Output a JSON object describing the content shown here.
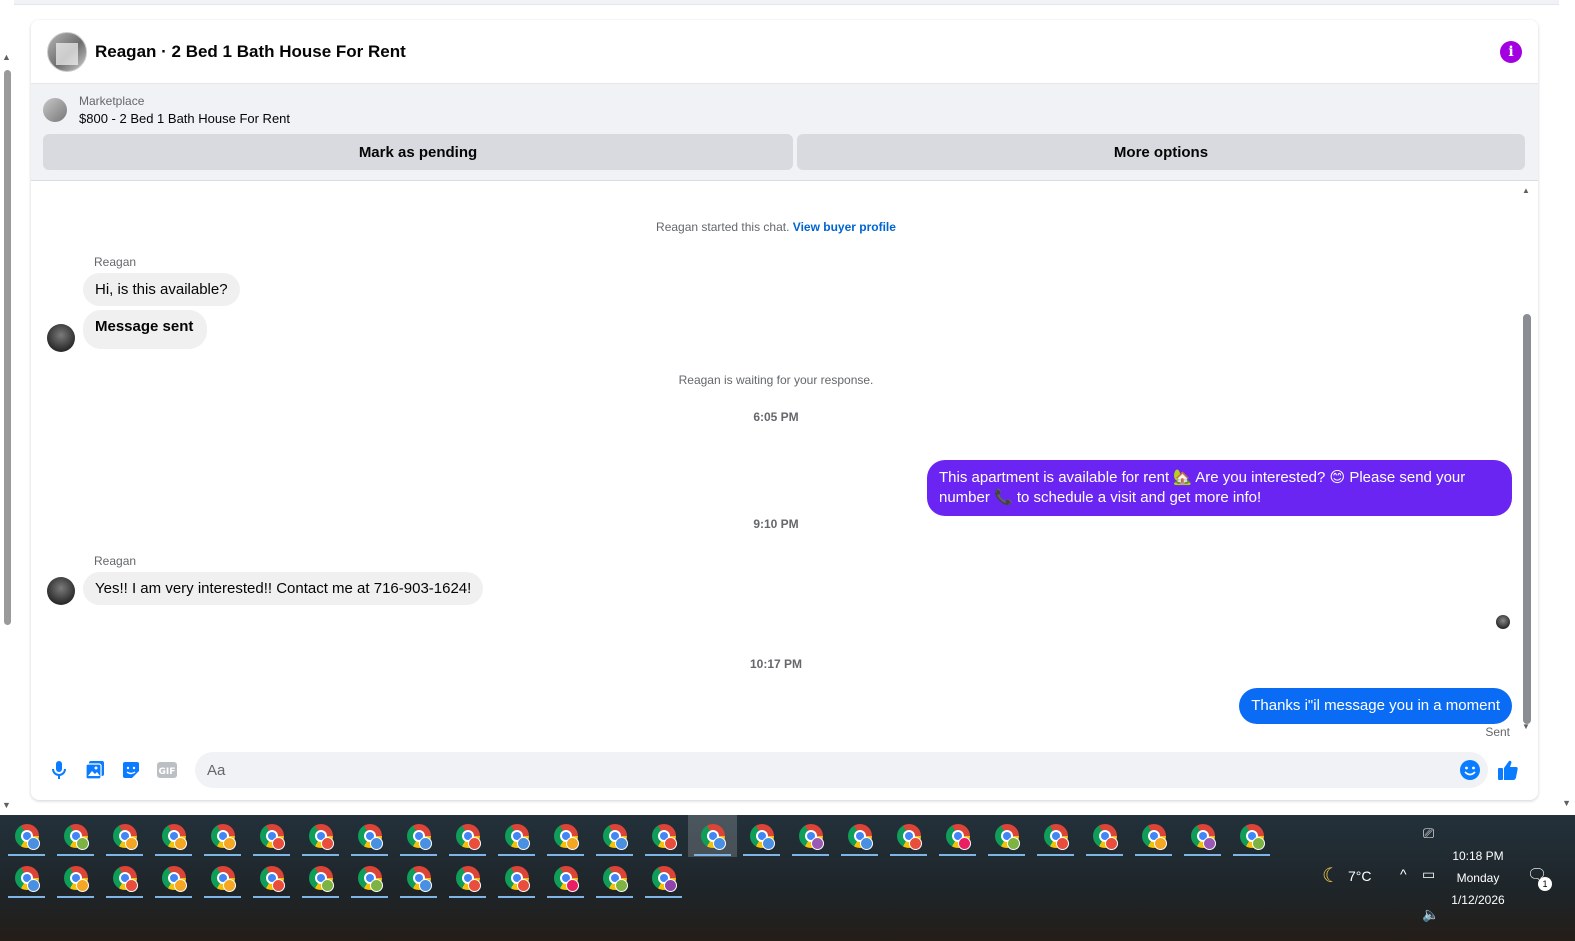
{
  "chat": {
    "title": "Reagan · 2 Bed 1 Bath House For Rent",
    "listing_label": "Marketplace",
    "listing_title": "$800 - 2 Bed 1 Bath House For Rent",
    "mark_pending_label": "Mark as pending",
    "more_options_label": "More options"
  },
  "messages": {
    "started_text": "Reagan started this chat.",
    "view_profile_link": "View buyer profile",
    "sender_name_1": "Reagan",
    "in_msg_1": "Hi, is this available?",
    "in_msg_2": "Message sent",
    "waiting_text": "Reagan is waiting for your response.",
    "time_1": "6:05 PM",
    "out_msg_1": "This apartment is available for rent 🏡 Are you interested? 😊 Please send your number 📞 to schedule a visit and get more info!",
    "time_2": "9:10 PM",
    "sender_name_2": "Reagan",
    "in_msg_3": "Yes!! I am very interested!! Contact me at 716-903-1624!",
    "time_3": "10:17 PM",
    "out_msg_2": "Thanks i\"il message you in a moment",
    "out_status": "Sent"
  },
  "composer": {
    "placeholder": "Aa"
  },
  "colors": {
    "outgoing_bubble_1": "#6b25f2",
    "outgoing_bubble_2": "#0a6cf5",
    "info_icon": "#a200e0",
    "accent_blue": "#0084ff"
  },
  "icons": {
    "header": "info-icon",
    "composer": [
      "microphone-icon",
      "photo-icon",
      "sticker-icon",
      "gif-icon",
      "emoji-icon",
      "thumbs-up-icon"
    ]
  },
  "taskbar": {
    "chrome_badge_colors_row1": [
      "#4a90e2",
      "#7cb342",
      "#f5a623",
      "#f5a623",
      "#f5a623",
      "#e94e3c",
      "#e94e3c",
      "#4a90e2",
      "#4a90e2",
      "#e94e3c",
      "#4a90e2",
      "#f5a623",
      "#4a90e2",
      "#e94e3c",
      "#4a90e2",
      "#4a90e2",
      "#9b59b6",
      "#4a90e2",
      "#e94e3c",
      "#e91e63",
      "#7cb342",
      "#e94e3c",
      "#e94e3c",
      "#f5a623",
      "#9b59b6",
      "#7cb342"
    ],
    "chrome_badge_colors_row2": [
      "#4a90e2",
      "#f5a623",
      "#e94e3c",
      "#f5a623",
      "#f5a623",
      "#e94e3c",
      "#7cb342",
      "#7cb342",
      "#4a90e2",
      "#e94e3c",
      "#e94e3c",
      "#e91e63",
      "#7cb342",
      "#8e44ad"
    ],
    "weather": "7°C",
    "time": "10:18 PM",
    "day": "Monday",
    "date": "1/12/2026",
    "notification_count": "1"
  }
}
